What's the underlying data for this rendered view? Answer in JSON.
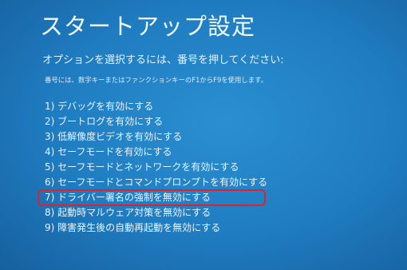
{
  "screen": {
    "title": "スタートアップ設定",
    "prompt": "オプションを選択するには、番号を押してください:",
    "hint": "番号には、数字キーまたはファンクションキーのF1からF9を使用します。",
    "options": [
      {
        "label": "1) デバッグを有効にする"
      },
      {
        "label": "2) ブートログを有効にする"
      },
      {
        "label": "3) 低解像度ビデオを有効にする"
      },
      {
        "label": "4) セーフモードを有効にする"
      },
      {
        "label": "5) セーフモードとネットワークを有効にする"
      },
      {
        "label": "6) セーフモードとコマンドプロンプトを有効にする"
      },
      {
        "label": "7) ドライバー署名の強制を無効にする"
      },
      {
        "label": "8) 起動時マルウェア対策を無効にする"
      },
      {
        "label": "9) 障害発生後の自動再起動を無効にする"
      }
    ],
    "highlight_color": "#d9232e",
    "background_color": "#1f7cc0"
  }
}
